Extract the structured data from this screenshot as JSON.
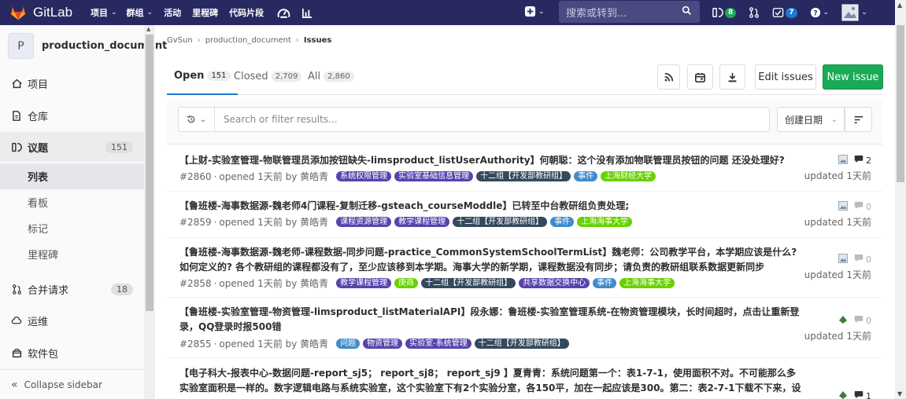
{
  "nav": {
    "brand": "GitLab",
    "items": [
      {
        "label": "项目",
        "has_dropdown": true
      },
      {
        "label": "群组",
        "has_dropdown": true
      },
      {
        "label": "活动",
        "has_dropdown": false
      },
      {
        "label": "里程碑",
        "has_dropdown": false
      },
      {
        "label": "代码片段",
        "has_dropdown": false
      }
    ],
    "search_placeholder": "搜索或转到...",
    "issues_count": "8",
    "todos_count": "7",
    "colors": {
      "bg": "#292961",
      "brand_orange": "#e24329",
      "green": "#1aaa55",
      "blue": "#1f78d1"
    }
  },
  "sidebar": {
    "project_avatar": "P",
    "project_name": "production_document",
    "items": [
      {
        "label": "项目",
        "icon": "home-icon"
      },
      {
        "label": "仓库",
        "icon": "doc-icon"
      },
      {
        "label": "议题",
        "icon": "issues-icon",
        "count": "151",
        "active": true
      },
      {
        "label": "合并请求",
        "icon": "merge-request-icon",
        "count": "18"
      },
      {
        "label": "运维",
        "icon": "cloud-gear-icon"
      },
      {
        "label": "软件包",
        "icon": "package-icon"
      }
    ],
    "subitems": [
      {
        "label": "列表",
        "active": true
      },
      {
        "label": "看板"
      },
      {
        "label": "标记"
      },
      {
        "label": "里程碑"
      }
    ],
    "collapse_label": "Collapse sidebar"
  },
  "breadcrumb": {
    "group": "GvSun",
    "project": "production_document",
    "current": "Issues"
  },
  "tabs": [
    {
      "label": "Open",
      "count": "151",
      "active": true
    },
    {
      "label": "Closed",
      "count": "2,709"
    },
    {
      "label": "All",
      "count": "2,860"
    }
  ],
  "actions": {
    "edit_label": "Edit issues",
    "new_label": "New issue"
  },
  "filter": {
    "placeholder": "Search or filter results...",
    "sort_label": "创建日期"
  },
  "issues": [
    {
      "title": "【上财-实验室管理-物联管理员添加按钮缺失-limsproduct_listUserAuthority】何朝聪：这个没有添加物联管理员按钮的问题 还没处理好?",
      "number": "#2860",
      "meta": "opened 1天前 by 黄皓青",
      "labels": [
        {
          "text": "系统权限管理",
          "color": "#5843ad"
        },
        {
          "text": "实验室基础信息管理",
          "color": "#5843ad"
        },
        {
          "text": "十二组【开发部教研组】",
          "color": "#34495e"
        },
        {
          "text": "事件",
          "color": "#428bca"
        },
        {
          "text": "上海财经大学",
          "color": "#69d100"
        }
      ],
      "comments": "2",
      "updated": "updated 1天前"
    },
    {
      "title": "【鲁班楼-海事数据源-魏老师4门课程-复制迁移-gsteach_courseModdle】已转至中台教研组负责处理;",
      "number": "#2859",
      "meta": "opened 1天前 by 黄皓青",
      "labels": [
        {
          "text": "课程资源管理",
          "color": "#5843ad"
        },
        {
          "text": "教学课程管理",
          "color": "#5843ad"
        },
        {
          "text": "十二组【开发部教研组】",
          "color": "#34495e"
        },
        {
          "text": "事件",
          "color": "#428bca"
        },
        {
          "text": "上海海事大学",
          "color": "#69d100"
        }
      ],
      "comments": "0",
      "updated": "updated 1天前"
    },
    {
      "title": "【鲁班楼-海事数据源-魏老师-课程数据-同步问题-practice_CommonSystemSchoolTermList】魏老师：公司教学平台，本学期应该是什么? 如何定义的? 各个教研组的课程都没有了，至少应该移到本学期。海事大学的新学期，课程数据没有同步；请负责的教研组联系数据更新同步",
      "number": "#2858",
      "meta": "opened 1天前 by 黄皓青",
      "labels": [
        {
          "text": "教学课程管理",
          "color": "#5843ad"
        },
        {
          "text": "庚商",
          "color": "#69d100"
        },
        {
          "text": "十二组【开发部教研组】",
          "color": "#34495e"
        },
        {
          "text": "共享数据交换中心",
          "color": "#5843ad"
        },
        {
          "text": "事件",
          "color": "#428bca"
        },
        {
          "text": "上海海事大学",
          "color": "#69d100"
        }
      ],
      "comments": "0",
      "updated": "updated 1天前"
    },
    {
      "title": "【鲁班楼-实验室管理-物资管理-limsproduct_listMaterialAPI】段永娜：鲁班楼-实验室管理系统-在物资管理模块，长时间超时，点击让重新登录，QQ登录时报500错",
      "number": "#2855",
      "meta": "opened 1天前 by 黄皓青",
      "labels": [
        {
          "text": "问题",
          "color": "#428bca"
        },
        {
          "text": "物资管理",
          "color": "#5843ad"
        },
        {
          "text": "实验室-系统管理",
          "color": "#5843ad"
        },
        {
          "text": "十二组【开发部教研组】",
          "color": "#34495e"
        }
      ],
      "comments": "0",
      "updated": "updated 1天前"
    },
    {
      "title": "【电子科大-报表中心-数据问题-report_sj5； report_sj8； report_sj9 】夏青青：系统问题第一个：表1-7-1，使用面积不对。不可能那么多实验室面积是一样的。数字逻辑电路与系统实验室，这个实验室下有2个实验分室，各150平，加在一起应该是300。第二：表2-7-1下载不下来，设",
      "number": "",
      "meta": "",
      "labels": [],
      "comments": "1",
      "updated": ""
    }
  ]
}
